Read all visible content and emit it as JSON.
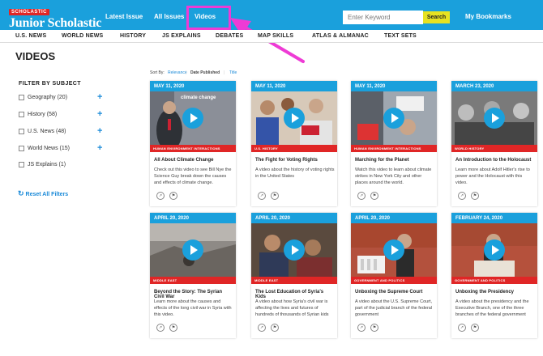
{
  "header": {
    "logo_badge": "SCHOLASTIC",
    "logo_title": "Junior Scholastic",
    "nav": [
      "Latest Issue",
      "All Issues",
      "Videos"
    ],
    "search_placeholder": "Enter Keyword",
    "search_button": "Search",
    "bookmarks": "My Bookmarks",
    "highlight_color": "#ee3bd5",
    "brand_blue": "#1aa0dc"
  },
  "subnav": [
    "U.S. NEWS",
    "WORLD NEWS",
    "HISTORY",
    "JS EXPLAINS",
    "DEBATES",
    "MAP SKILLS",
    "ATLAS & ALMANAC",
    "TEXT SETS"
  ],
  "page_title": "VIDEOS",
  "filters": {
    "title": "FILTER BY SUBJECT",
    "items": [
      {
        "label": "Geography (20)",
        "expandable": true
      },
      {
        "label": "History (58)",
        "expandable": true
      },
      {
        "label": "U.S. News (48)",
        "expandable": true
      },
      {
        "label": "World News (15)",
        "expandable": true
      },
      {
        "label": "JS Explains (1)",
        "expandable": false
      }
    ],
    "reset": "Reset All Filters",
    "reset_icon": "refresh-icon"
  },
  "sort": {
    "label": "Sort By:",
    "options": [
      "Relevance",
      "Date Published",
      "Title"
    ],
    "selected": "Date Published"
  },
  "cards": [
    {
      "date": "MAY 11, 2020",
      "tag": "HUMAN ENVIRONMENT INTERACTIONS",
      "title": "All About Climate Change",
      "desc": "Check out this video to see Bill Nye the Science Guy break down the causes and effects of climate change.",
      "thumb_caption": "climate change"
    },
    {
      "date": "MAY 11, 2020",
      "tag": "U.S. HISTORY",
      "title": "The Fight for Voting Rights",
      "desc": "A video about the history of voting rights in the United States"
    },
    {
      "date": "MAY 11, 2020",
      "tag": "HUMAN ENVIRONMENT INTERACTIONS",
      "title": "Marching for the Planet",
      "desc": "Watch this video to learn about climate strikes in New York City and other places around the world."
    },
    {
      "date": "MARCH 23, 2020",
      "tag": "WORLD HISTORY",
      "title": "An Introduction to the Holocaust",
      "desc": "Learn more about Adolf Hitler's rise to power and the Holocaust with this video."
    },
    {
      "date": "APRIL 20, 2020",
      "tag": "MIDDLE EAST",
      "title": "Beyond the Story: The Syrian Civil War",
      "desc": "Learn more about the causes and effects of the long civil war in Syria with this video."
    },
    {
      "date": "APRIL 20, 2020",
      "tag": "MIDDLE EAST",
      "title": "The Lost Education of Syria's Kids",
      "desc": "A video about how Syria's civil war is affecting the lives and futures of hundreds of thousands of Syrian kids"
    },
    {
      "date": "APRIL 20, 2020",
      "tag": "GOVERNMENT AND POLITICS",
      "title": "Unboxing the Supreme Court",
      "desc": "A video about the U.S. Supreme Court, part of the judicial branch of the federal government"
    },
    {
      "date": "FEBRUARY 24, 2020",
      "tag": "GOVERNMENT AND POLITICS",
      "title": "Unboxing the Presidency",
      "desc": "A video about the presidency and the Executive Branch, one of the three branches of the federal government"
    }
  ]
}
